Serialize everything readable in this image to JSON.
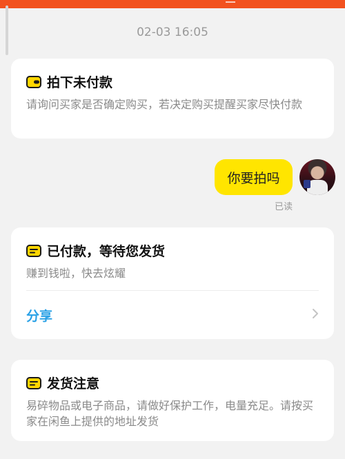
{
  "header": {
    "accent_color": "#f2521f"
  },
  "chat": {
    "timestamp": "02-03 16:05",
    "message": {
      "text": "你要拍吗",
      "read_status": "已读",
      "bubble_color": "#ffe500"
    }
  },
  "cards": {
    "unpaid": {
      "icon": "wallet-icon",
      "title": "拍下未付款",
      "description": "请询问买家是否确定购买，若决定购买提醒买家尽快付款"
    },
    "paid": {
      "icon": "order-card-icon",
      "title": "已付款，等待您发货",
      "description": "赚到钱啦，快去炫耀",
      "share_label": "分享",
      "share_color": "#2aa1e6"
    },
    "shipping": {
      "icon": "order-card-icon",
      "title": "发货注意",
      "description": "易碎物品或电子商品，请做好保护工作，电量充足。请按买家在闲鱼上提供的地址发货"
    }
  }
}
